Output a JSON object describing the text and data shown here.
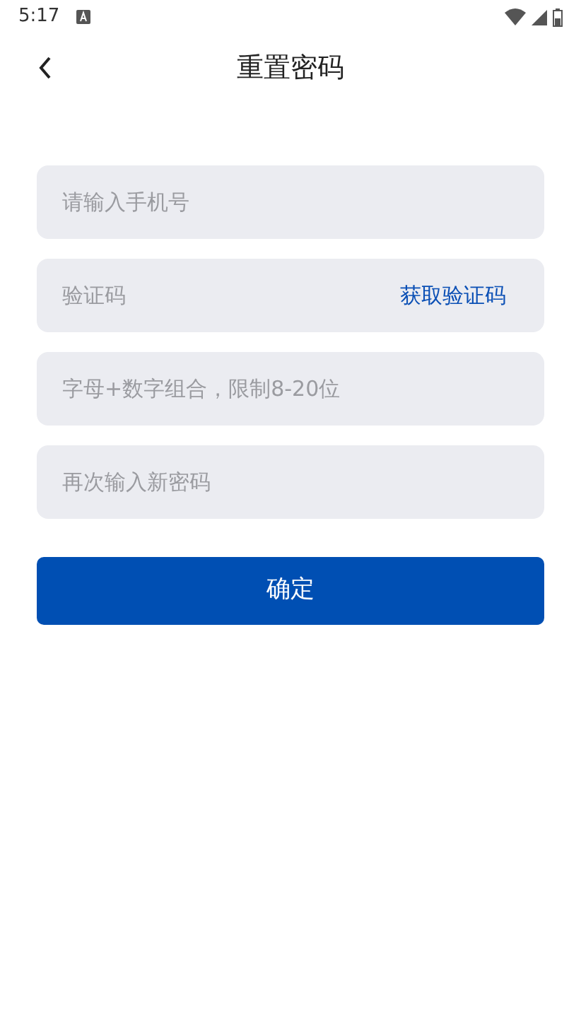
{
  "status_bar": {
    "time": "5:17"
  },
  "header": {
    "title": "重置密码"
  },
  "fields": [
    {
      "kind": "text",
      "placeholder": "请输入手机号"
    },
    {
      "kind": "code",
      "placeholder": "验证码",
      "action": "获取验证码"
    },
    {
      "kind": "password",
      "placeholder": "字母+数字组合，限制8-20位"
    },
    {
      "kind": "password",
      "placeholder": "再次输入新密码"
    }
  ],
  "submit": {
    "label": "确定"
  }
}
